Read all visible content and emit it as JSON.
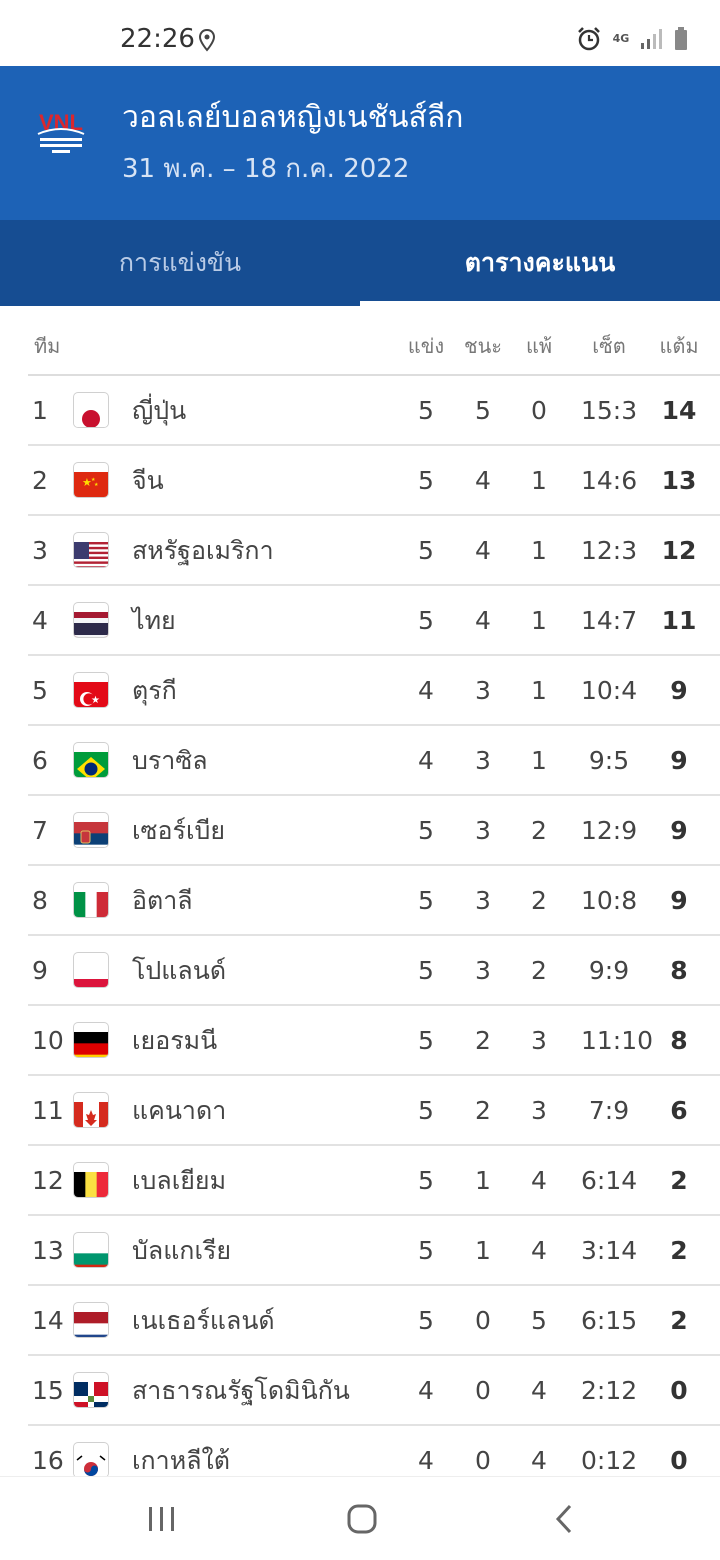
{
  "status_bar": {
    "time": "22:26",
    "network": "4G",
    "icons": [
      "location-icon",
      "alarm-icon",
      "signal-icon",
      "battery-icon"
    ]
  },
  "header": {
    "logo_text": "VNL",
    "title": "วอลเลย์บอลหญิงเนชันส์ลีก",
    "dates": "31 พ.ค. – 18 ก.ค. 2022",
    "bg_color": "#1d62b6"
  },
  "tabs": [
    {
      "label": "การแข่งขัน",
      "active": false
    },
    {
      "label": "ตารางคะแนน",
      "active": true
    }
  ],
  "table": {
    "headers": {
      "team": "ทีม",
      "played": "แข่ง",
      "won": "ชนะ",
      "lost": "แพ้",
      "sets": "เซ็ต",
      "points": "แต้ม"
    },
    "rows": [
      {
        "rank": "1",
        "flag": "japan",
        "team": "ญี่ปุ่น",
        "played": "5",
        "won": "5",
        "lost": "0",
        "sets": "15:3",
        "points": "14"
      },
      {
        "rank": "2",
        "flag": "china",
        "team": "จีน",
        "played": "5",
        "won": "4",
        "lost": "1",
        "sets": "14:6",
        "points": "13"
      },
      {
        "rank": "3",
        "flag": "usa",
        "team": "สหรัฐอเมริกา",
        "played": "5",
        "won": "4",
        "lost": "1",
        "sets": "12:3",
        "points": "12"
      },
      {
        "rank": "4",
        "flag": "thailand",
        "team": "ไทย",
        "played": "5",
        "won": "4",
        "lost": "1",
        "sets": "14:7",
        "points": "11"
      },
      {
        "rank": "5",
        "flag": "turkey",
        "team": "ตุรกี",
        "played": "4",
        "won": "3",
        "lost": "1",
        "sets": "10:4",
        "points": "9"
      },
      {
        "rank": "6",
        "flag": "brazil",
        "team": "บราซิล",
        "played": "4",
        "won": "3",
        "lost": "1",
        "sets": "9:5",
        "points": "9"
      },
      {
        "rank": "7",
        "flag": "serbia",
        "team": "เซอร์เบีย",
        "played": "5",
        "won": "3",
        "lost": "2",
        "sets": "12:9",
        "points": "9"
      },
      {
        "rank": "8",
        "flag": "italy",
        "team": "อิตาลี",
        "played": "5",
        "won": "3",
        "lost": "2",
        "sets": "10:8",
        "points": "9"
      },
      {
        "rank": "9",
        "flag": "poland",
        "team": "โปแลนด์",
        "played": "5",
        "won": "3",
        "lost": "2",
        "sets": "9:9",
        "points": "8"
      },
      {
        "rank": "10",
        "flag": "germany",
        "team": "เยอรมนี",
        "played": "5",
        "won": "2",
        "lost": "3",
        "sets": "11:10",
        "points": "8"
      },
      {
        "rank": "11",
        "flag": "canada",
        "team": "แคนาดา",
        "played": "5",
        "won": "2",
        "lost": "3",
        "sets": "7:9",
        "points": "6"
      },
      {
        "rank": "12",
        "flag": "belgium",
        "team": "เบลเยียม",
        "played": "5",
        "won": "1",
        "lost": "4",
        "sets": "6:14",
        "points": "2"
      },
      {
        "rank": "13",
        "flag": "bulgaria",
        "team": "บัลแกเรีย",
        "played": "5",
        "won": "1",
        "lost": "4",
        "sets": "3:14",
        "points": "2"
      },
      {
        "rank": "14",
        "flag": "netherlands",
        "team": "เนเธอร์แลนด์",
        "played": "5",
        "won": "0",
        "lost": "5",
        "sets": "6:15",
        "points": "2"
      },
      {
        "rank": "15",
        "flag": "dominican-republic",
        "team": "สาธารณรัฐโดมินิกัน",
        "played": "4",
        "won": "0",
        "lost": "4",
        "sets": "2:12",
        "points": "0"
      },
      {
        "rank": "16",
        "flag": "south-korea",
        "team": "เกาหลีใต้",
        "played": "4",
        "won": "0",
        "lost": "4",
        "sets": "0:12",
        "points": "0"
      }
    ]
  },
  "nav_bar": {
    "buttons": [
      "recent-apps-icon",
      "home-icon",
      "back-icon"
    ]
  }
}
